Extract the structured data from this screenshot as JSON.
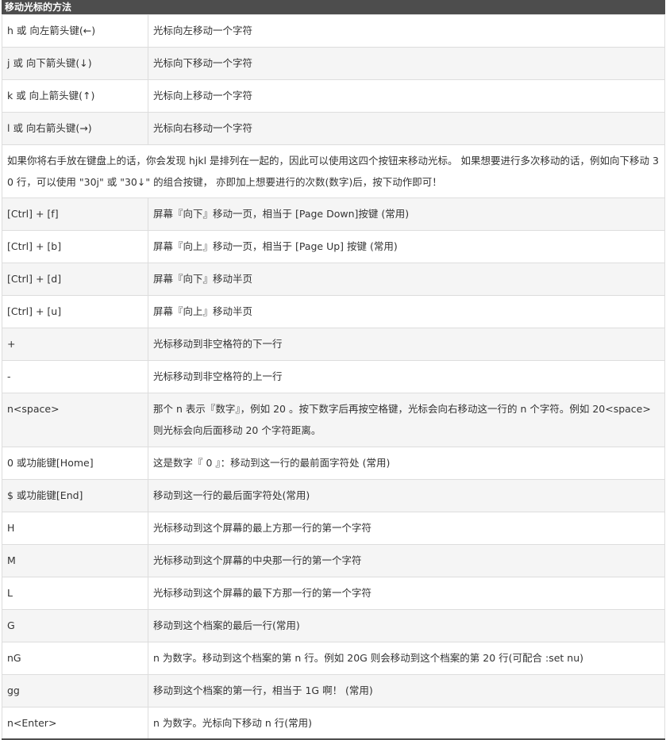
{
  "title": "移动光标的方法",
  "rows": [
    {
      "key": "h 或 向左箭头键(←)",
      "desc": "光标向左移动一个字符"
    },
    {
      "key": "j 或 向下箭头键(↓)",
      "desc": "光标向下移动一个字符"
    },
    {
      "key": "k 或 向上箭头键(↑)",
      "desc": "光标向上移动一个字符"
    },
    {
      "key": "l 或 向右箭头键(→)",
      "desc": "光标向右移动一个字符"
    }
  ],
  "note": "如果你将右手放在键盘上的话，你会发现 hjkl 是排列在一起的，因此可以使用这四个按钮来移动光标。 如果想要进行多次移动的话，例如向下移动 30 行，可以使用 \"30j\" 或 \"30↓\" 的组合按键， 亦即加上想要进行的次数(数字)后，按下动作即可！",
  "rows2": [
    {
      "key": "[Ctrl] + [f]",
      "desc": "屏幕『向下』移动一页，相当于 [Page Down]按键 (常用)"
    },
    {
      "key": "[Ctrl] + [b]",
      "desc": "屏幕『向上』移动一页，相当于 [Page Up] 按键 (常用)"
    },
    {
      "key": "[Ctrl] + [d]",
      "desc": "屏幕『向下』移动半页"
    },
    {
      "key": "[Ctrl] + [u]",
      "desc": "屏幕『向上』移动半页"
    },
    {
      "key": "+",
      "desc": "光标移动到非空格符的下一行"
    },
    {
      "key": "-",
      "desc": "光标移动到非空格符的上一行"
    },
    {
      "key": "n<space>",
      "desc": "那个 n 表示『数字』，例如 20 。按下数字后再按空格键，光标会向右移动这一行的 n 个字符。例如 20<space> 则光标会向后面移动 20 个字符距离。"
    },
    {
      "key": "0 或功能键[Home]",
      "desc": "这是数字『 0 』：移动到这一行的最前面字符处 (常用)"
    },
    {
      "key": "$ 或功能键[End]",
      "desc": "移动到这一行的最后面字符处(常用)"
    },
    {
      "key": "H",
      "desc": "光标移动到这个屏幕的最上方那一行的第一个字符"
    },
    {
      "key": "M",
      "desc": "光标移动到这个屏幕的中央那一行的第一个字符"
    },
    {
      "key": "L",
      "desc": "光标移动到这个屏幕的最下方那一行的第一个字符"
    },
    {
      "key": "G",
      "desc": "移动到这个档案的最后一行(常用)"
    },
    {
      "key": "nG",
      "desc": "n 为数字。移动到这个档案的第 n 行。例如 20G 则会移动到这个档案的第 20 行(可配合 :set nu)"
    },
    {
      "key": "gg",
      "desc": "移动到这个档案的第一行，相当于 1G 啊！ (常用)"
    },
    {
      "key": "n<Enter>",
      "desc": "n 为数字。光标向下移动 n 行(常用)"
    }
  ]
}
